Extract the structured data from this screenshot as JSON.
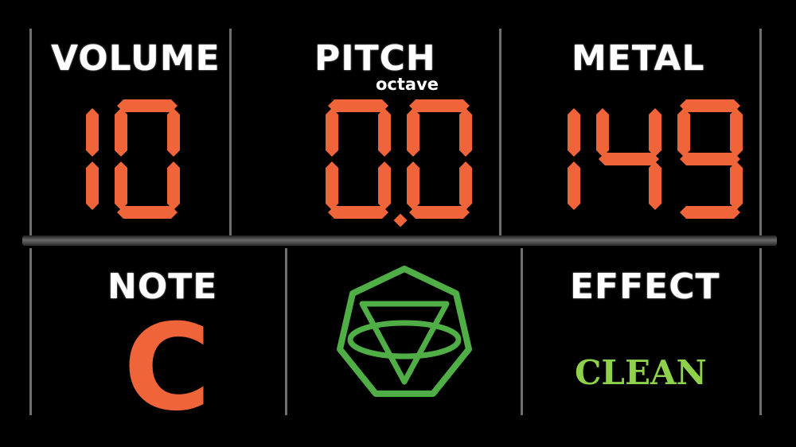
{
  "volume": {
    "label": "VOLUME",
    "value": "10"
  },
  "pitch": {
    "label": "PITCH",
    "sublabel": "octave",
    "value": "0.0"
  },
  "metal": {
    "label": "METAL",
    "value": "149"
  },
  "note": {
    "label": "NOTE",
    "value": "C"
  },
  "logo_icon": "heptagon-triangle-logo-icon",
  "effect": {
    "label": "EFFECT",
    "value": "CLEAN"
  },
  "colors": {
    "display": "#f0643a",
    "accent": "#4fae45",
    "effect": "#8fd14a",
    "background": "#000000"
  }
}
